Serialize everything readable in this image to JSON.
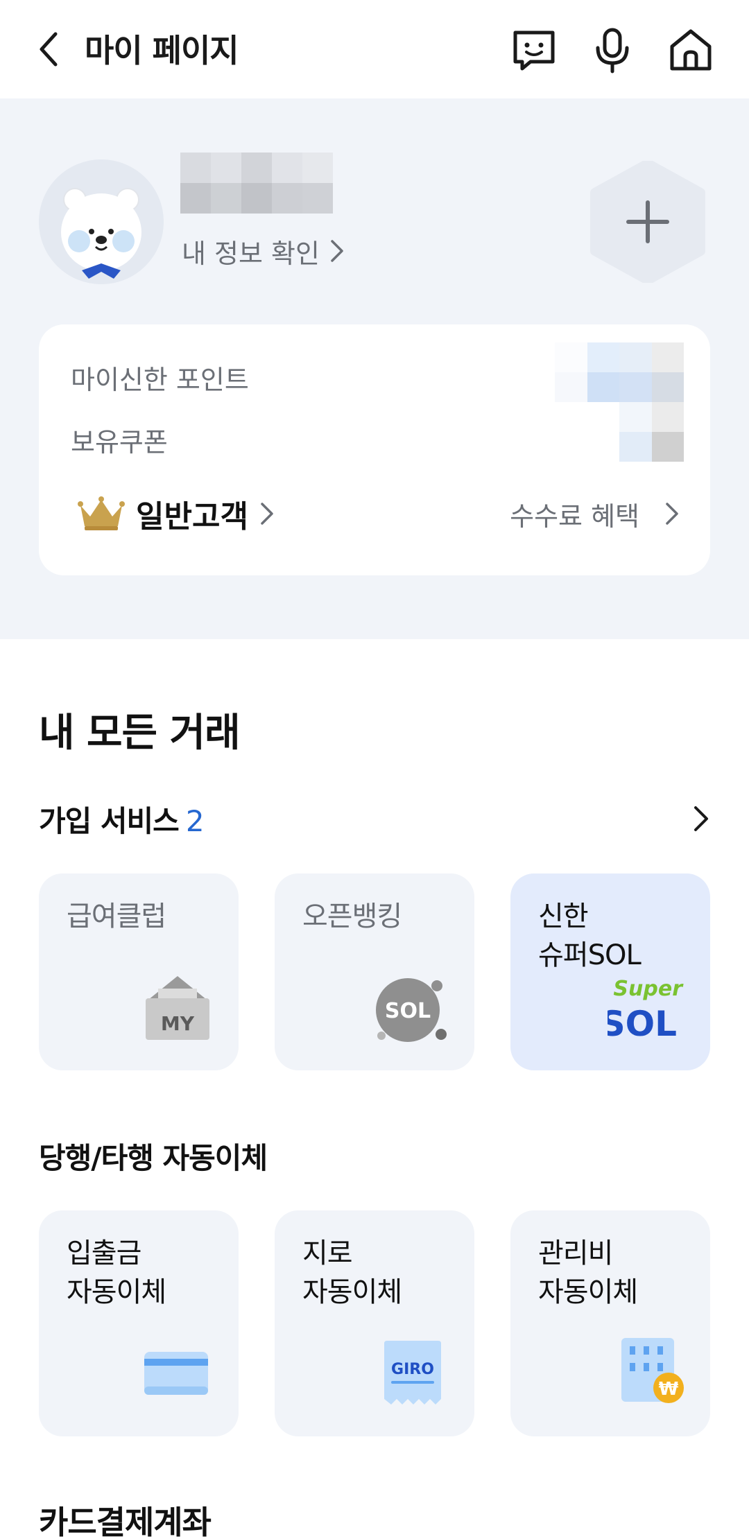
{
  "header": {
    "title": "마이 페이지",
    "icons": [
      "back-icon",
      "chatbot-icon",
      "mic-icon",
      "home-icon"
    ]
  },
  "profile": {
    "my_info_link": "내 정보 확인",
    "points_label": "마이신한 포인트",
    "coupons_label": "보유쿠폰",
    "grade": "일반고객",
    "fee_benefit": "수수료 혜택",
    "colors": {
      "section_bg": "#f1f4f9",
      "crown": "#c9a24e"
    }
  },
  "transactions": {
    "title": "내 모든 거래",
    "services": {
      "title": "가입 서비스",
      "count": "2",
      "tiles": [
        {
          "label": "급여클럽",
          "art_text": "MY"
        },
        {
          "label": "오픈뱅킹",
          "art_text": "SOL"
        },
        {
          "label": "신한\n슈퍼SOL",
          "art_top": "Super",
          "art_bottom": "SOL"
        }
      ]
    },
    "auto_transfer": {
      "title": "당행/타행 자동이체",
      "tiles": [
        {
          "label": "입출금\n자동이체"
        },
        {
          "label": "지로\n자동이체",
          "art_text": "GIRO"
        },
        {
          "label": "관리비\n자동이체",
          "art_badge": "₩"
        }
      ]
    },
    "card_account_title": "카드결제계좌"
  }
}
